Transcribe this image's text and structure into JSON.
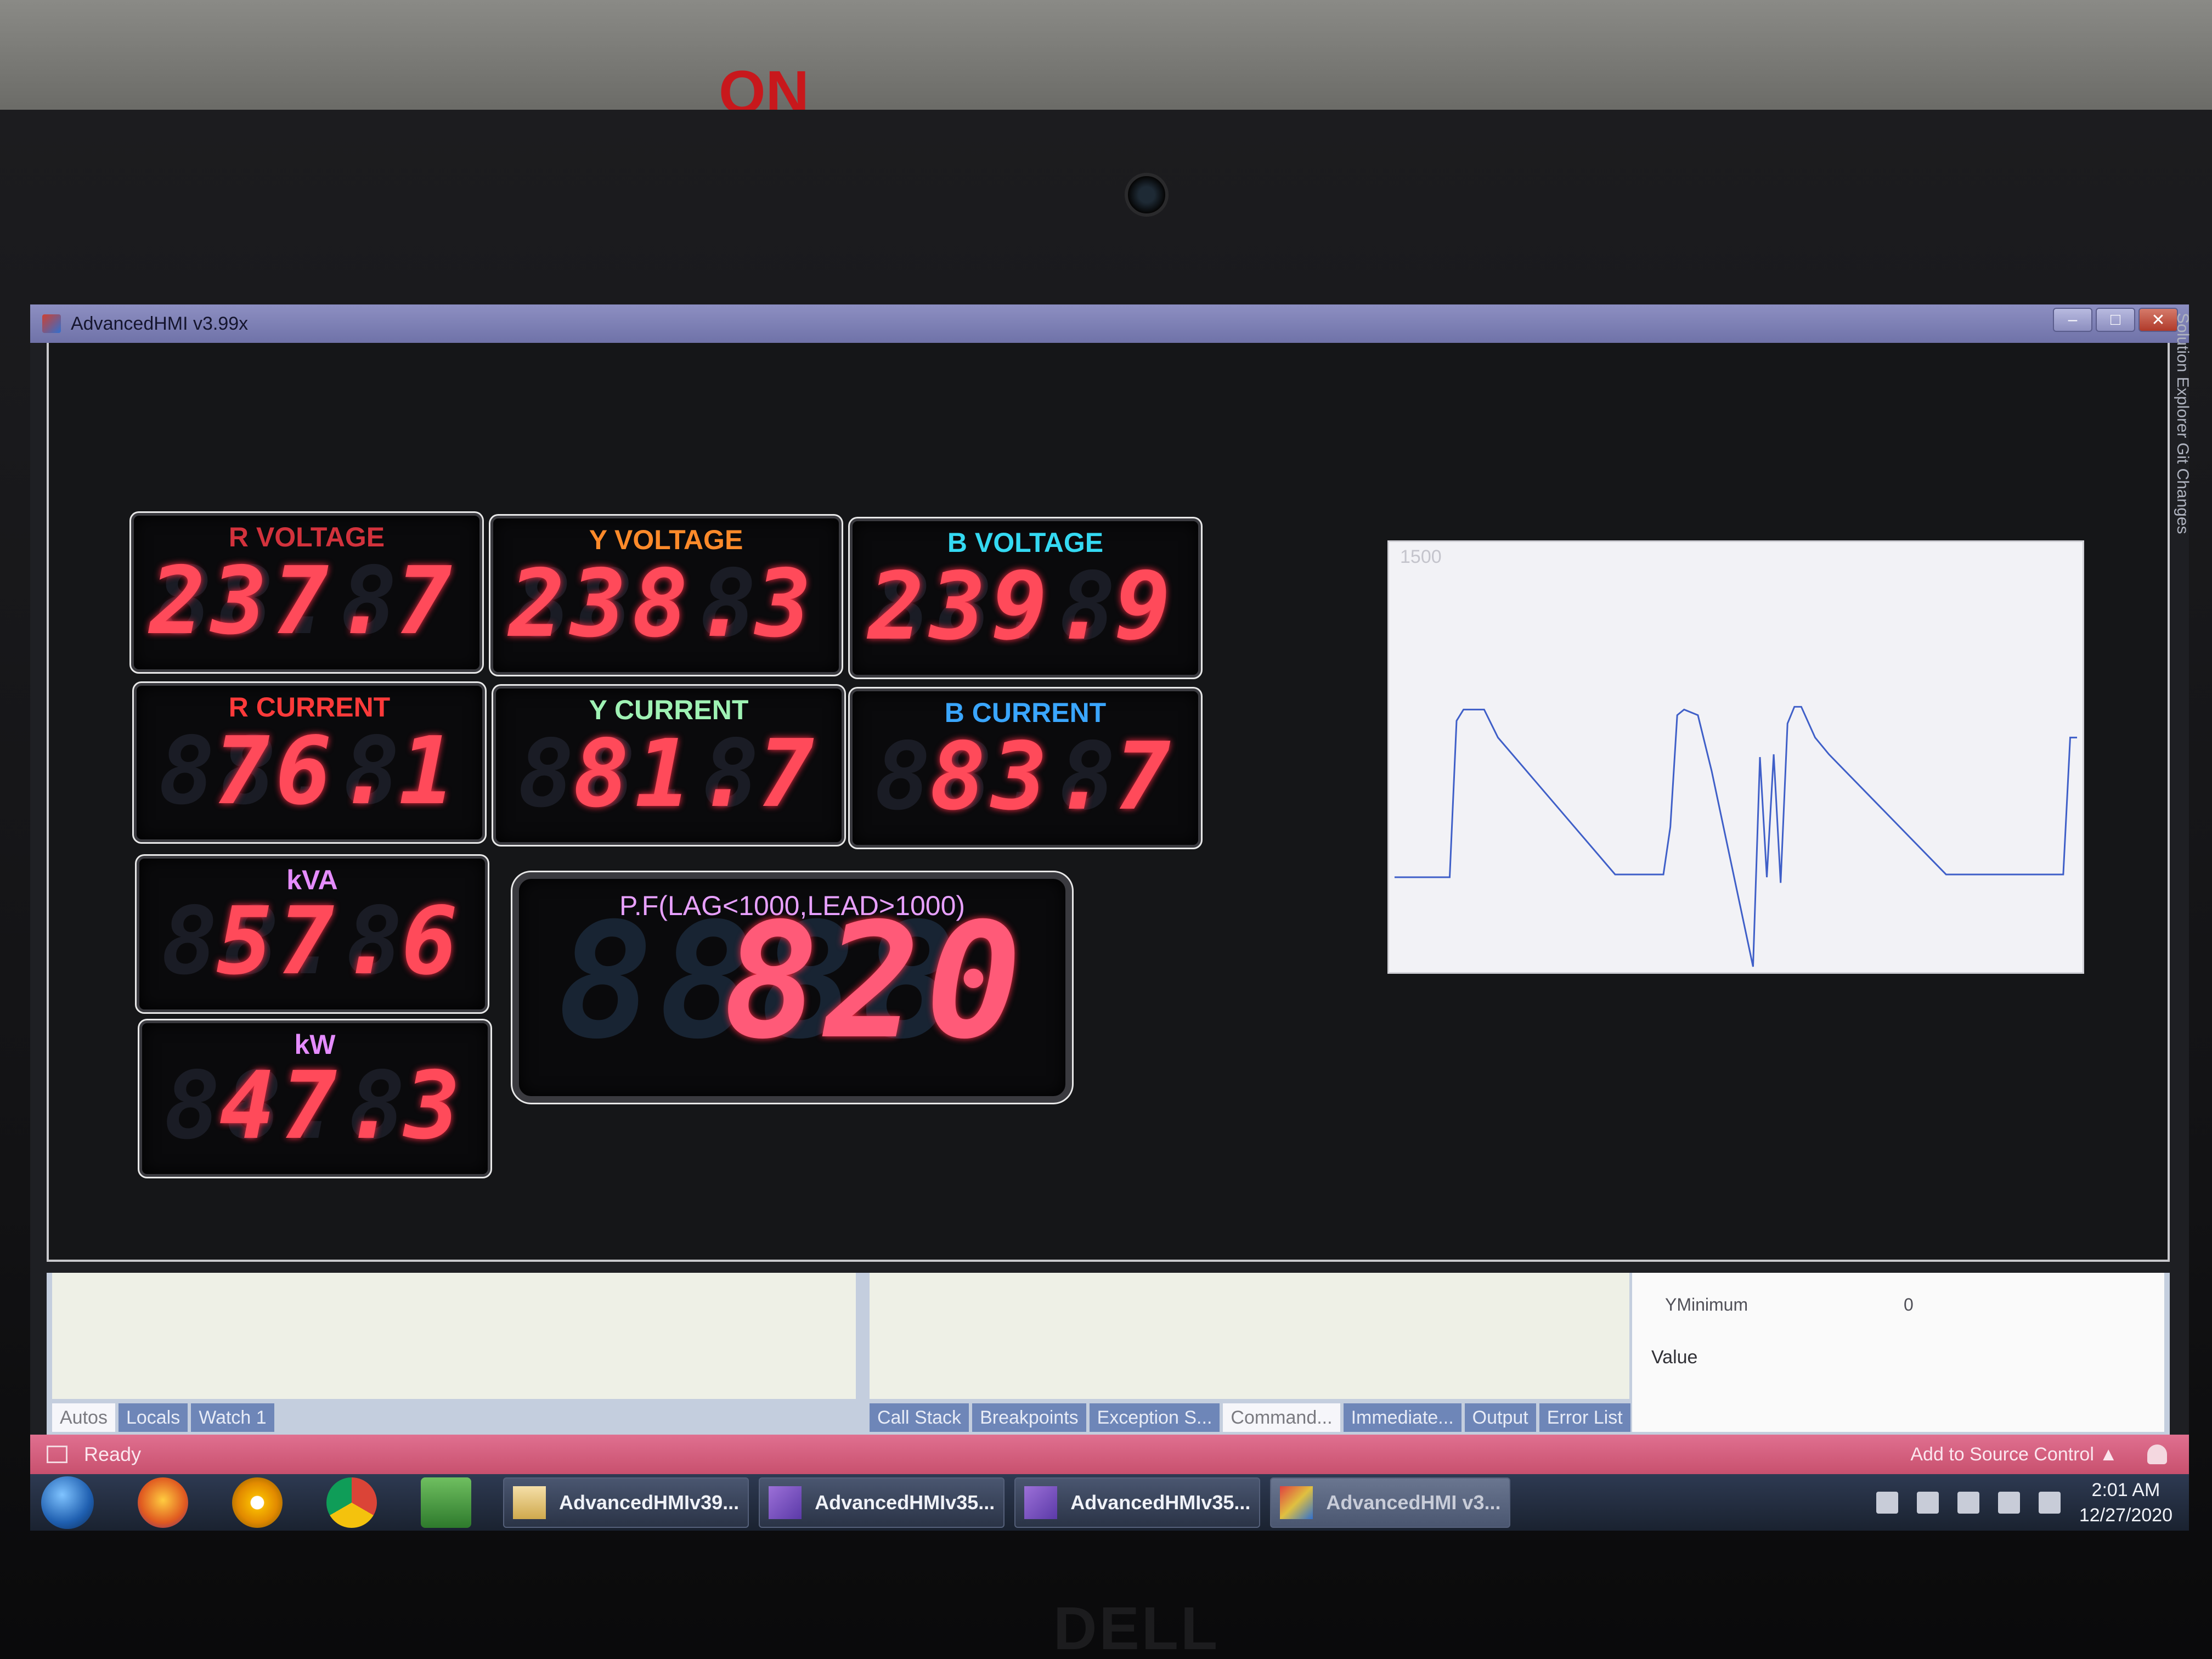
{
  "environment": {
    "sign_text": "ON",
    "brand": "DELL"
  },
  "window": {
    "title": "AdvancedHMI v3.99x",
    "minimize": "–",
    "maximize": "□",
    "close": "✕"
  },
  "meters": {
    "r_voltage": {
      "label": "R VOLTAGE",
      "value": "237.7",
      "color": "#d2323c"
    },
    "y_voltage": {
      "label": "Y VOLTAGE",
      "value": "238.3",
      "color": "#ff8a2a"
    },
    "b_voltage": {
      "label": "B VOLTAGE",
      "value": "239.9",
      "color": "#34d9f2"
    },
    "r_current": {
      "label": "R CURRENT",
      "value": "76.1",
      "color": "#ff3a3a"
    },
    "y_current": {
      "label": "Y CURRENT",
      "value": "81.7",
      "color": "#9ff2b4"
    },
    "b_current": {
      "label": "B CURRENT",
      "value": "83.7",
      "color": "#3aa6ff"
    },
    "kva": {
      "label": "kVA",
      "value": "57.6",
      "color": "#e58cff"
    },
    "kw": {
      "label": "kW",
      "value": "47.3",
      "color": "#e58cff"
    },
    "pf": {
      "label": "P.F(LAG<1000,LEAD>1000)",
      "value": "820",
      "color": "#e8a0ff"
    }
  },
  "chart_data": {
    "type": "line",
    "ymax_label": "1500",
    "ylim": [
      0,
      1500
    ],
    "grid": false,
    "x": [
      0,
      8,
      9,
      10,
      13,
      15,
      32,
      39,
      40,
      41,
      42,
      44,
      46,
      52,
      53,
      54,
      55,
      56,
      57,
      58,
      59,
      61,
      63,
      80,
      97,
      98,
      99
    ],
    "series": [
      {
        "values": [
          320,
          320,
          880,
          920,
          920,
          820,
          330,
          330,
          500,
          900,
          920,
          900,
          700,
          0,
          750,
          320,
          760,
          300,
          870,
          930,
          930,
          820,
          760,
          330,
          330,
          820,
          820
        ],
        "color": "#3f5fc8"
      }
    ]
  },
  "bottom_panels": {
    "left_tabs": [
      "Autos",
      "Locals",
      "Watch 1"
    ],
    "left_active": "Autos",
    "middle_tabs": [
      "Call Stack",
      "Breakpoints",
      "Exception S...",
      "Command...",
      "Immediate...",
      "Output",
      "Error List"
    ],
    "middle_active": "Command...",
    "properties": {
      "ymin_name": "YMinimum",
      "ymin_value": "0",
      "value_label": "Value"
    }
  },
  "statusbar": {
    "status": "Ready",
    "source_control": "Add to Source Control ▲"
  },
  "taskbar": {
    "tasks": [
      {
        "label": "AdvancedHMIv39...",
        "icon": "folder-icon"
      },
      {
        "label": "AdvancedHMIv35...",
        "icon": "visual-studio-icon"
      },
      {
        "label": "AdvancedHMIv35...",
        "icon": "visual-studio-icon"
      },
      {
        "label": "AdvancedHMI v3...",
        "icon": "hmi-icon"
      }
    ],
    "clock_time": "2:01 AM",
    "clock_date": "12/27/2020"
  },
  "side_strip": "Solution Explorer   Git Changes"
}
